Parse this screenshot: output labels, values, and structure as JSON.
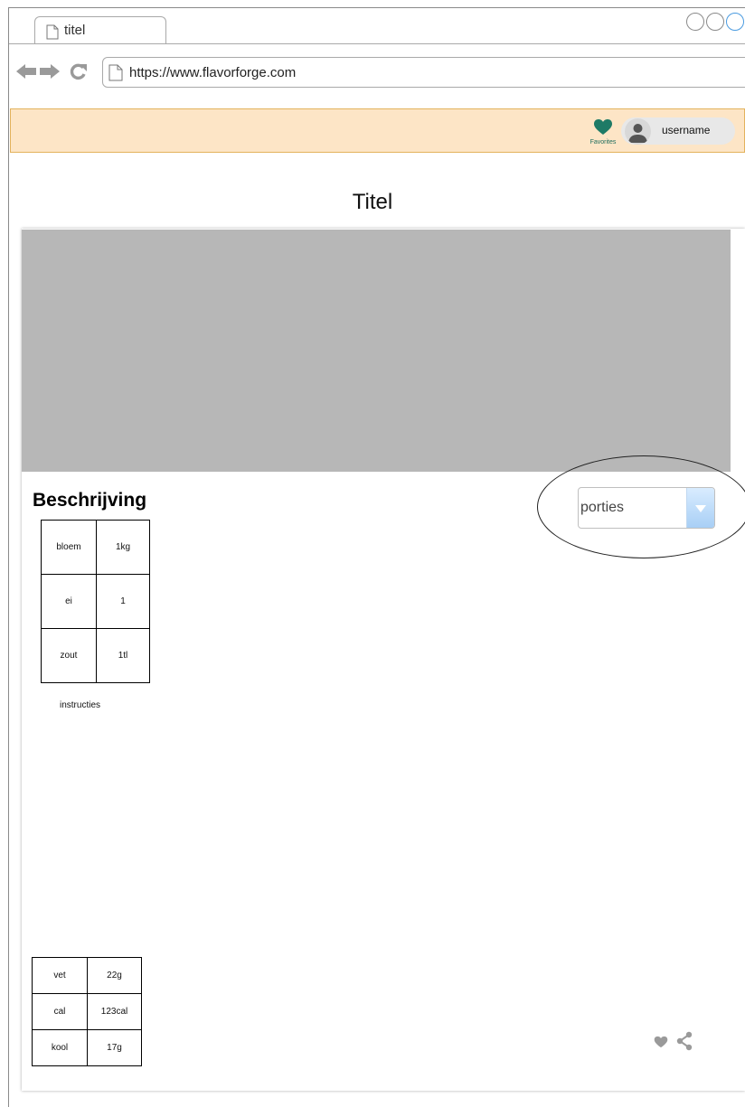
{
  "browser": {
    "tab_title": "titel",
    "url": "https://www.flavorforge.com"
  },
  "header": {
    "favorites_label": "Favorites",
    "username": "username",
    "favorites_icon": "heart-icon",
    "avatar_icon": "user-avatar-icon"
  },
  "page": {
    "title": "Titel",
    "description_heading": "Beschrijving",
    "instructions_label": "instructies"
  },
  "portions_select": {
    "value": "porties"
  },
  "ingredients": [
    {
      "name": "bloem",
      "amount": "1kg"
    },
    {
      "name": "ei",
      "amount": "1"
    },
    {
      "name": "zout",
      "amount": "1tl"
    }
  ],
  "nutrition": [
    {
      "name": "vet",
      "amount": "22g"
    },
    {
      "name": "cal",
      "amount": "123cal"
    },
    {
      "name": "kool",
      "amount": "17g"
    }
  ],
  "actions": [
    "heart-icon",
    "share-icon"
  ],
  "colors": {
    "header_bg": "#fde5c6",
    "header_border": "#e3b25c",
    "favorite_heart": "#1e7a66",
    "image_placeholder": "#b7b7b7",
    "select_button": "#a8cff5"
  }
}
